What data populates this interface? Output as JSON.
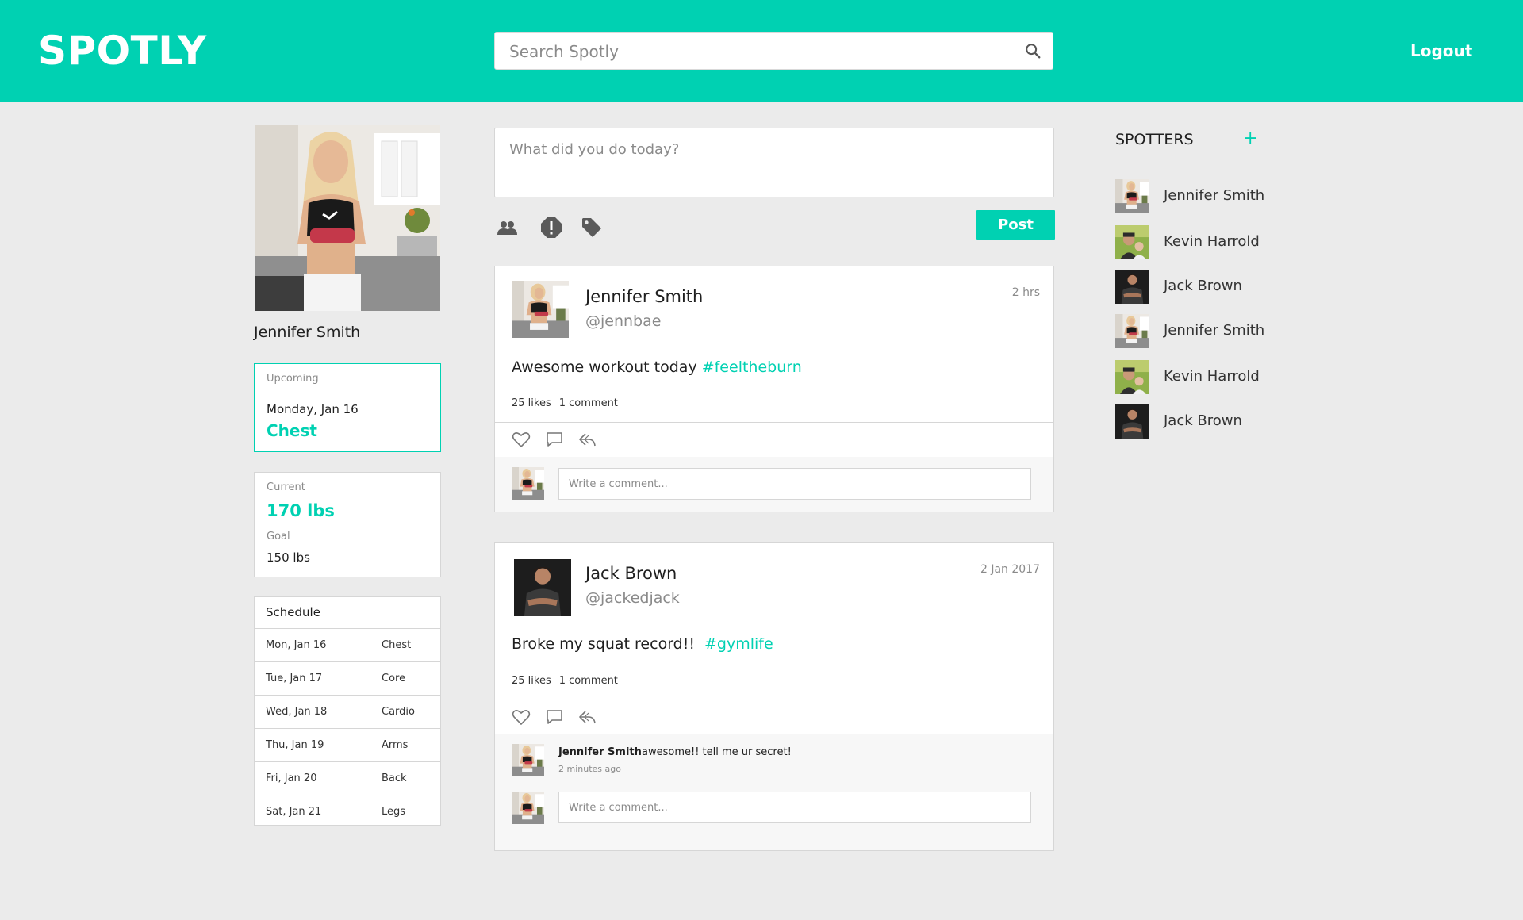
{
  "header": {
    "logo": "SPOTLY",
    "search_placeholder": "Search Spotly",
    "logout_label": "Logout",
    "brand_color": "#00d1b2"
  },
  "profile": {
    "name": "Jennifer Smith",
    "upcoming": {
      "label": "Upcoming",
      "date": "Monday, Jan 16",
      "workout": "Chest"
    },
    "weight": {
      "current_label": "Current",
      "current_value": "170 lbs",
      "goal_label": "Goal",
      "goal_value": "150 lbs"
    },
    "schedule": {
      "title": "Schedule",
      "rows": [
        {
          "date": "Mon, Jan 16",
          "workout": "Chest"
        },
        {
          "date": "Tue, Jan 17",
          "workout": "Core"
        },
        {
          "date": "Wed, Jan 18",
          "workout": "Cardio"
        },
        {
          "date": "Thu, Jan 19",
          "workout": "Arms"
        },
        {
          "date": "Fri, Jan 20",
          "workout": "Back"
        },
        {
          "date": "Sat, Jan 21",
          "workout": "Legs"
        }
      ]
    }
  },
  "composer": {
    "placeholder": "What did you do today?",
    "post_label": "Post",
    "tools": [
      "people-icon",
      "alert-icon",
      "tag-icon"
    ]
  },
  "posts": [
    {
      "author": "Jennifer Smith",
      "handle": "@jennbae",
      "time": "2 hrs",
      "text": "Awesome workout today",
      "tag": "#feeltheburn",
      "likes": "25 likes",
      "comments_count": "1 comment",
      "comment_placeholder": "Write a comment..."
    },
    {
      "author": "Jack Brown",
      "handle": "@jackedjack",
      "time": "2 Jan 2017",
      "text": "Broke my squat record!!",
      "tag": "#gymlife",
      "likes": "25 likes",
      "comments_count": "1 comment",
      "comments": [
        {
          "author": "Jennifer Smith",
          "text": "awesome!! tell me ur secret!",
          "time": "2 minutes ago"
        }
      ],
      "comment_placeholder": "Write a comment..."
    }
  ],
  "spotters": {
    "title": "SPOTTERS",
    "add_label": "+",
    "people": [
      {
        "name": "Jennifer Smith"
      },
      {
        "name": "Kevin Harrold"
      },
      {
        "name": "Jack Brown"
      },
      {
        "name": "Jennifer Smith"
      },
      {
        "name": "Kevin Harrold"
      },
      {
        "name": "Jack Brown"
      }
    ]
  }
}
